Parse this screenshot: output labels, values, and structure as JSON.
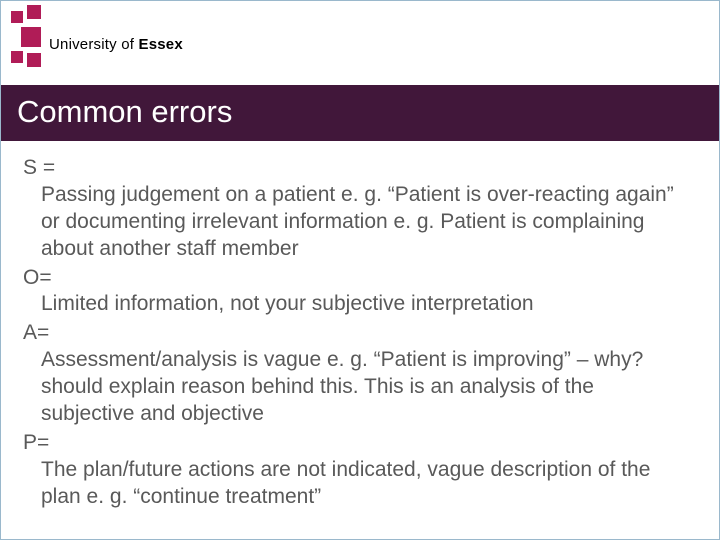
{
  "logo": {
    "text_prefix": "University of ",
    "text_bold": "Essex"
  },
  "title": "Common errors",
  "items": [
    {
      "key": "S =",
      "text": " Passing judgement on a patient e. g. “Patient is over-reacting again” or documenting irrelevant information e. g. Patient is complaining about another staff member"
    },
    {
      "key": "O=",
      "text": "  Limited information, not your subjective interpretation"
    },
    {
      "key": "A=",
      "text": " Assessment/analysis is vague e. g. “Patient is improving” – why? should explain reason behind this. This is an analysis of the subjective and objective"
    },
    {
      "key": "P=",
      "text": " The plan/future actions are not indicated, vague description of the plan e. g. “continue treatment”"
    }
  ]
}
